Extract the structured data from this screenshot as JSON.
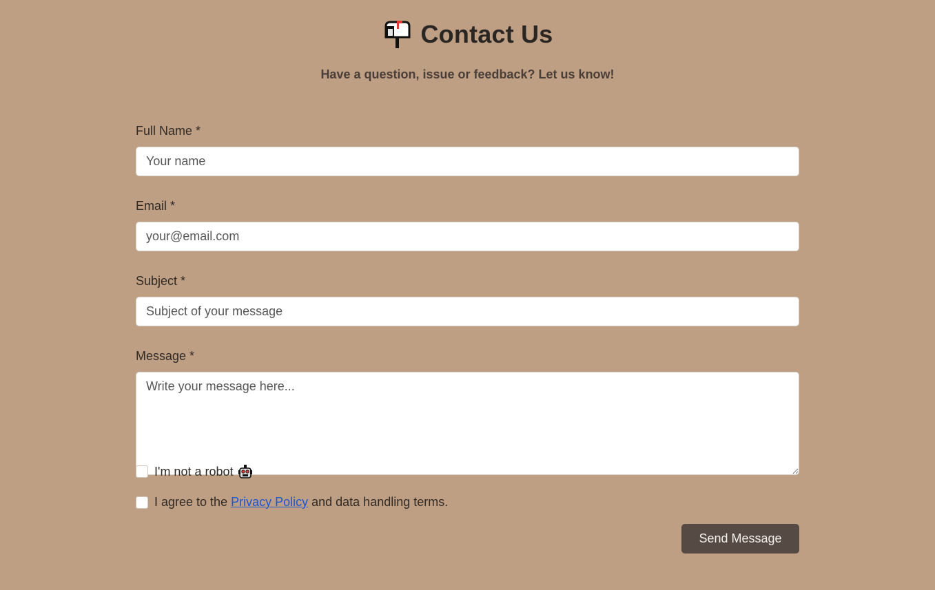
{
  "header": {
    "icon": "mailbox-icon",
    "title": "Contact Us",
    "subtitle": "Have a question, issue or feedback? Let us know!"
  },
  "form": {
    "name": {
      "label": "Full Name *",
      "placeholder": "Your name",
      "value": ""
    },
    "email": {
      "label": "Email *",
      "placeholder": "your@email.com",
      "value": ""
    },
    "subject": {
      "label": "Subject *",
      "placeholder": "Subject of your message",
      "value": ""
    },
    "message": {
      "label": "Message *",
      "placeholder": "Write your message here...",
      "value": ""
    },
    "robot": {
      "label": "I'm not a robot",
      "icon": "robot-icon",
      "checked": false
    },
    "agree": {
      "prefix": "I agree to the",
      "link_text": "Privacy Policy",
      "suffix": "and data handling terms.",
      "checked": false
    },
    "submit_label": "Send Message"
  },
  "colors": {
    "background": "#bf9f83",
    "button": "#554a44",
    "link": "#1a55d8"
  }
}
